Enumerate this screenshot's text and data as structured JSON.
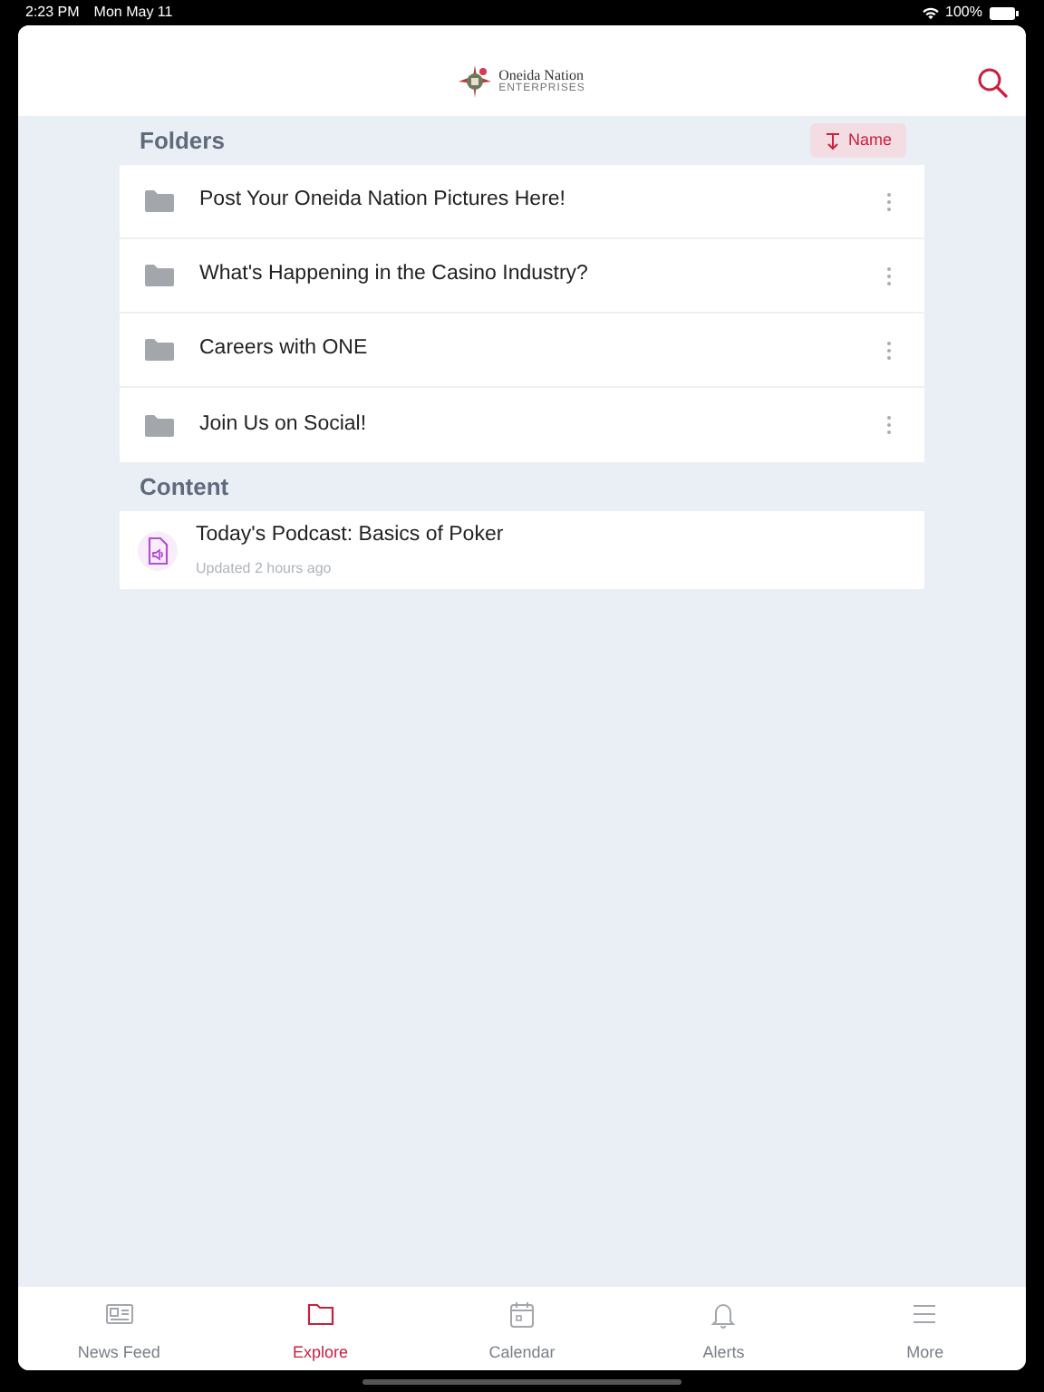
{
  "status_bar": {
    "time": "2:23 PM",
    "date": "Mon May 11",
    "battery": "100%"
  },
  "header": {
    "logo_title": "Oneida Nation",
    "logo_subtitle": "ENTERPRISES"
  },
  "folders": {
    "title": "Folders",
    "sort_label": "Name",
    "items": [
      {
        "name": "Post Your Oneida Nation Pictures Here!"
      },
      {
        "name": "What's Happening in the Casino Industry?"
      },
      {
        "name": "Careers with ONE"
      },
      {
        "name": "Join Us on Social!"
      }
    ]
  },
  "content": {
    "title": "Content",
    "items": [
      {
        "title": "Today's Podcast: Basics of Poker",
        "updated": "Updated 2 hours ago"
      }
    ]
  },
  "tabs": [
    {
      "label": "News Feed",
      "kind": "news",
      "selected": false
    },
    {
      "label": "Explore",
      "kind": "folder",
      "selected": true
    },
    {
      "label": "Calendar",
      "kind": "calendar",
      "selected": false
    },
    {
      "label": "Alerts",
      "kind": "bell",
      "selected": false
    },
    {
      "label": "More",
      "kind": "menu",
      "selected": false
    }
  ]
}
